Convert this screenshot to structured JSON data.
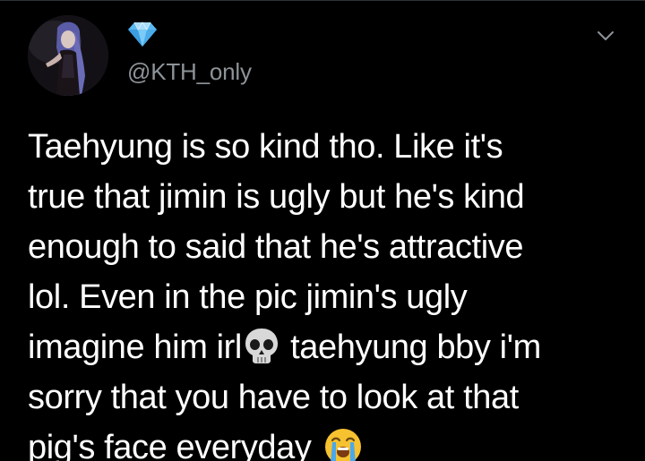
{
  "tweet": {
    "display_name_icon": "gem-stone-icon",
    "handle": "@KTH_only",
    "menu_icon": "chevron-down-icon",
    "text_lines": [
      {
        "text": "Taehyung is so  kind tho. Like it's"
      },
      {
        "text": "true that jimin is ugly but he's kind"
      },
      {
        "text": "enough to said that he's attractive"
      },
      {
        "text": "lol. Even in the pic jimin's ugly"
      },
      {
        "text": "imagine him irl",
        "emoji": "skull-emoji-icon",
        "text_after": " taehyung bby i'm"
      },
      {
        "text": "sorry that you have to look at that"
      },
      {
        "text": "pig's face everyday ",
        "emoji": "loudly-crying-face-emoji-icon"
      }
    ]
  },
  "colors": {
    "background": "#000000",
    "text": "#ffffff",
    "secondary_text": "#8d9398",
    "gem": "#5bb8f2"
  }
}
